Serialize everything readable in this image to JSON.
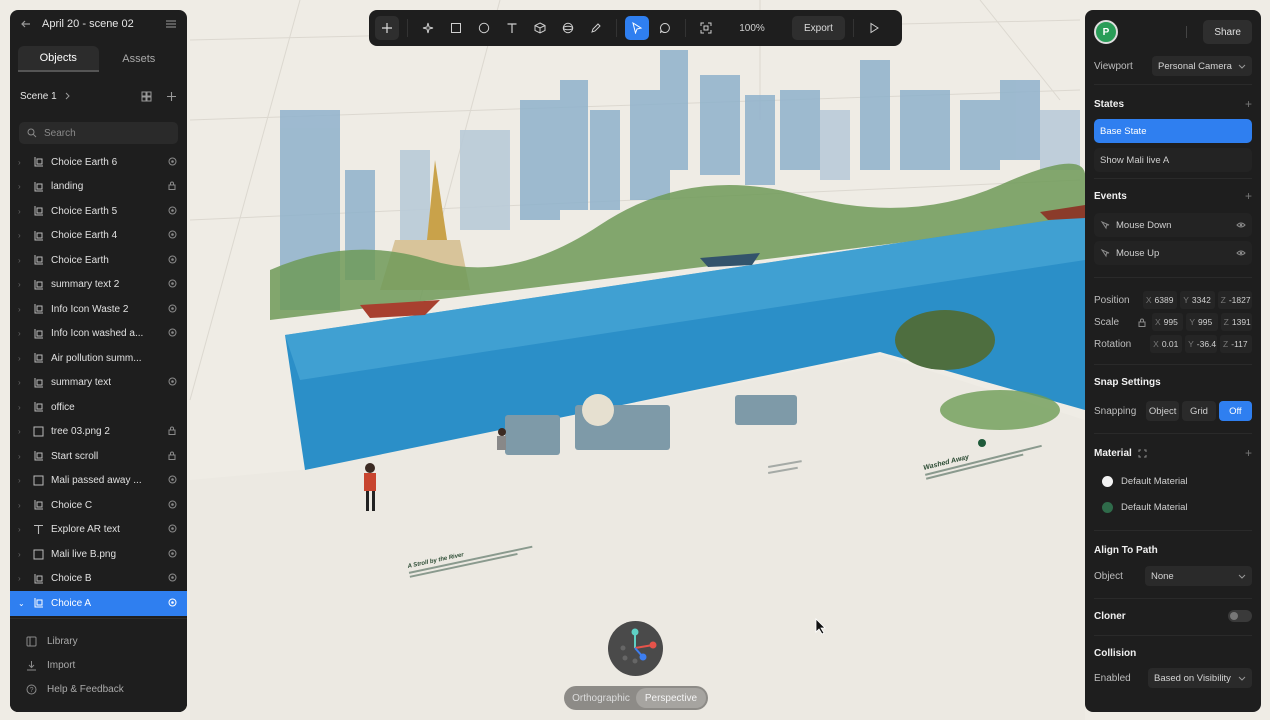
{
  "project": {
    "title": "April 20 - scene 02"
  },
  "left_tabs": [
    {
      "label": "Objects"
    },
    {
      "label": "Assets"
    }
  ],
  "scene": {
    "name": "Scene 1"
  },
  "search": {
    "placeholder": "Search"
  },
  "layers": [
    {
      "name": "Choice Earth 6",
      "type": "group-icon",
      "state": "eye-icon"
    },
    {
      "name": "landing",
      "type": "group-icon",
      "state": "lock-icon"
    },
    {
      "name": "Choice Earth 5",
      "type": "group-icon",
      "state": "eye-icon"
    },
    {
      "name": "Choice Earth 4",
      "type": "group-icon",
      "state": "eye-icon"
    },
    {
      "name": "Choice Earth",
      "type": "group-icon",
      "state": "eye-icon"
    },
    {
      "name": "summary text 2",
      "type": "group-icon",
      "state": "eye-icon"
    },
    {
      "name": "Info Icon Waste 2",
      "type": "group-icon",
      "state": "eye-icon"
    },
    {
      "name": "Info Icon washed a...",
      "type": "group-icon",
      "state": "eye-icon"
    },
    {
      "name": "Air pollution summ...",
      "type": "group-icon",
      "state": ""
    },
    {
      "name": "summary text",
      "type": "group-icon",
      "state": "eye-icon"
    },
    {
      "name": "office",
      "type": "group-icon",
      "state": ""
    },
    {
      "name": "tree 03.png 2",
      "type": "image-icon",
      "state": "lock-icon"
    },
    {
      "name": "Start scroll",
      "type": "group-icon",
      "state": "lock-icon"
    },
    {
      "name": "Mali passed away ...",
      "type": "image-icon",
      "state": "eye-icon"
    },
    {
      "name": "Choice C",
      "type": "group-icon",
      "state": "eye-icon"
    },
    {
      "name": "Explore AR text",
      "type": "text-icon",
      "state": "eye-icon"
    },
    {
      "name": "Mali live B.png",
      "type": "image-icon",
      "state": "eye-icon"
    },
    {
      "name": "Choice B",
      "type": "group-icon",
      "state": "eye-icon"
    },
    {
      "name": "Choice A",
      "type": "group-icon",
      "state": "eye-icon",
      "selected": true
    }
  ],
  "footer": [
    {
      "label": "Library"
    },
    {
      "label": "Import"
    },
    {
      "label": "Help & Feedback"
    }
  ],
  "toolbar": {
    "zoom": "100%",
    "export_label": "Export"
  },
  "right": {
    "avatar_initial": "P",
    "share_label": "Share",
    "viewport_label": "Viewport",
    "viewport_value": "Personal Camera",
    "states_title": "States",
    "states": [
      {
        "label": "Base State",
        "active": true
      },
      {
        "label": "Show Mali live A"
      }
    ],
    "events_title": "Events",
    "events": [
      {
        "label": "Mouse Down"
      },
      {
        "label": "Mouse Up"
      }
    ],
    "position": {
      "label": "Position",
      "x": "6389",
      "y": "3342",
      "z": "-1827"
    },
    "scale": {
      "label": "Scale",
      "x": "995",
      "y": "995",
      "z": "1391"
    },
    "rotation": {
      "label": "Rotation",
      "x": "0.01",
      "y": "-36.4",
      "z": "-117"
    },
    "snap_title": "Snap Settings",
    "snapping_label": "Snapping",
    "snap_options": [
      {
        "label": "Object"
      },
      {
        "label": "Grid"
      },
      {
        "label": "Off",
        "active": true
      }
    ],
    "material_title": "Material",
    "materials": [
      {
        "label": "Default Material",
        "color": "#f2f2f2"
      },
      {
        "label": "Default Material",
        "color": "#2f6b4a"
      }
    ],
    "align_title": "Align To Path",
    "align_object_label": "Object",
    "align_object_value": "None",
    "cloner_label": "Cloner",
    "collision_title": "Collision",
    "enabled_label": "Enabled",
    "enabled_value": "Based on Visibility"
  },
  "camera": {
    "options": [
      {
        "label": "Orthographic"
      },
      {
        "label": "Perspective",
        "active": true
      }
    ]
  },
  "scene_text": {
    "stroll_title": "A Stroll by the River",
    "washed_title": "Washed Away"
  },
  "colors": {
    "accent": "#2f7ff0",
    "panel": "#1e1e1e",
    "canvas": "#efece5",
    "water": "#2b8fc8"
  }
}
